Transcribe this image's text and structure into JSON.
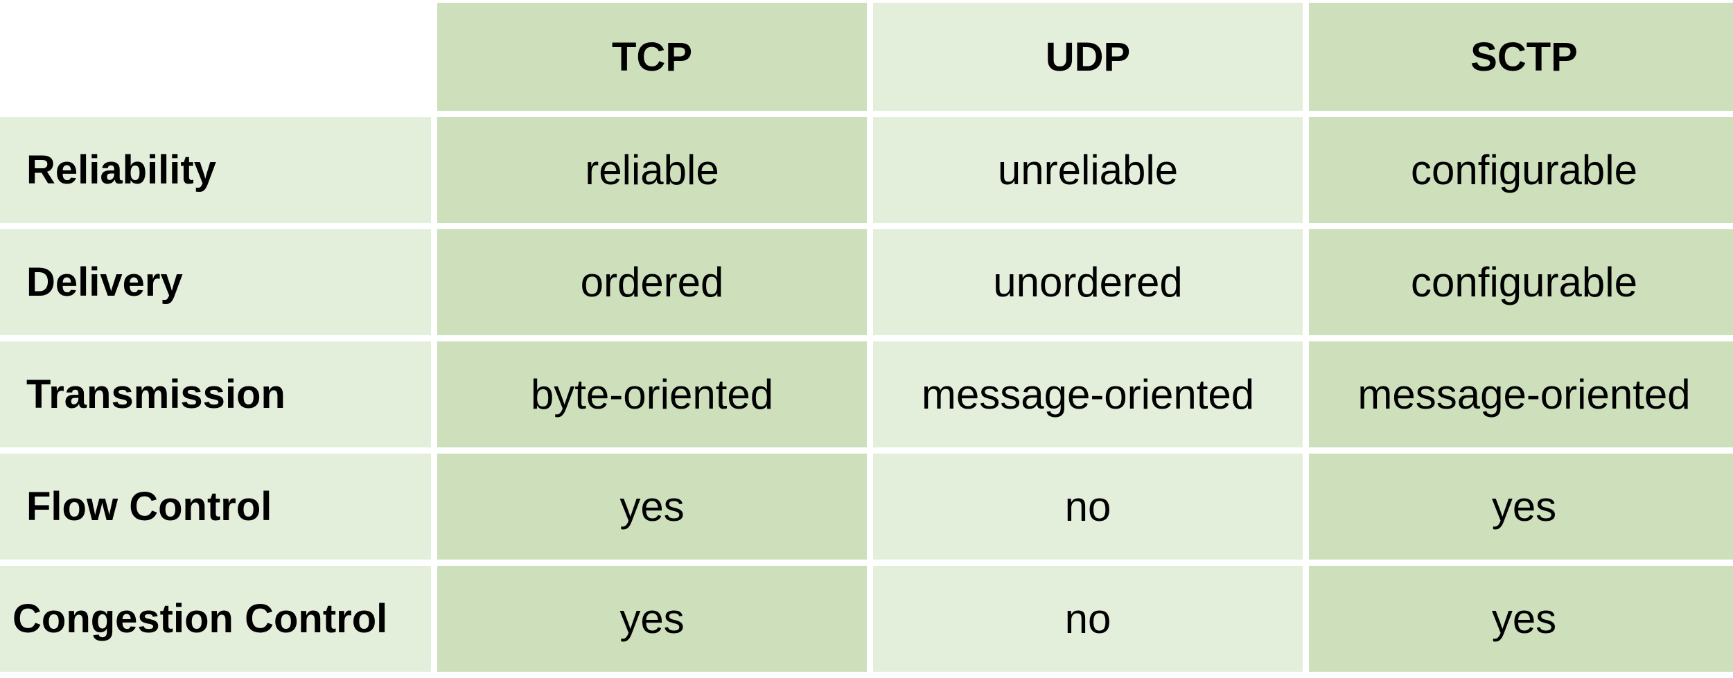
{
  "columns": [
    "TCP",
    "UDP",
    "SCTP"
  ],
  "rows": [
    {
      "label": "Reliability",
      "values": [
        "reliable",
        "unreliable",
        "configurable"
      ]
    },
    {
      "label": "Delivery",
      "values": [
        "ordered",
        "unordered",
        "configurable"
      ]
    },
    {
      "label": "Transmission",
      "values": [
        "byte-oriented",
        "message-oriented",
        "message-oriented"
      ]
    },
    {
      "label": "Flow Control",
      "values": [
        "yes",
        "no",
        "yes"
      ]
    },
    {
      "label": "Congestion Control",
      "values": [
        "yes",
        "no",
        "yes"
      ]
    }
  ],
  "colors": {
    "dark": "#cddfbb",
    "light": "#e4efdb"
  }
}
